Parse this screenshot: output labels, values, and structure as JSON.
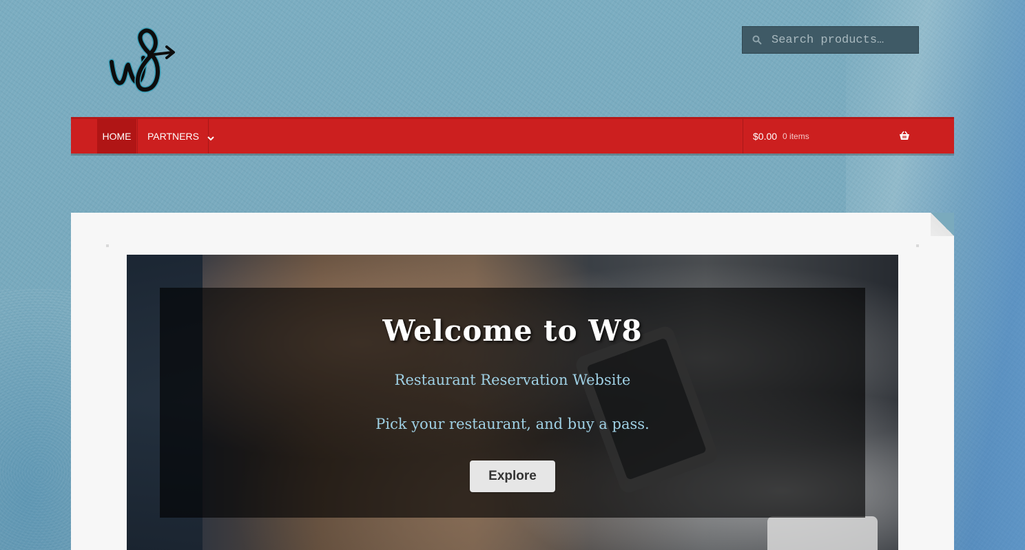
{
  "header": {
    "logo_alt": "W8",
    "search": {
      "placeholder": "Search products…",
      "value": ""
    }
  },
  "nav": {
    "items": [
      {
        "label": "HOME",
        "active": true
      },
      {
        "label": "PARTNERS",
        "has_dropdown": true
      }
    ],
    "cart": {
      "amount": "$0.00",
      "count": "0 items"
    }
  },
  "hero": {
    "title": "Welcome to W8",
    "subtitle": "Restaurant Reservation Website",
    "tagline": "Pick your restaurant, and buy a pass.",
    "button_label": "Explore"
  },
  "colors": {
    "nav_bg": "#cc1f1f",
    "nav_active": "#b01515",
    "page_bg": "#7aaabd",
    "accent_text": "#9fd0e4"
  }
}
